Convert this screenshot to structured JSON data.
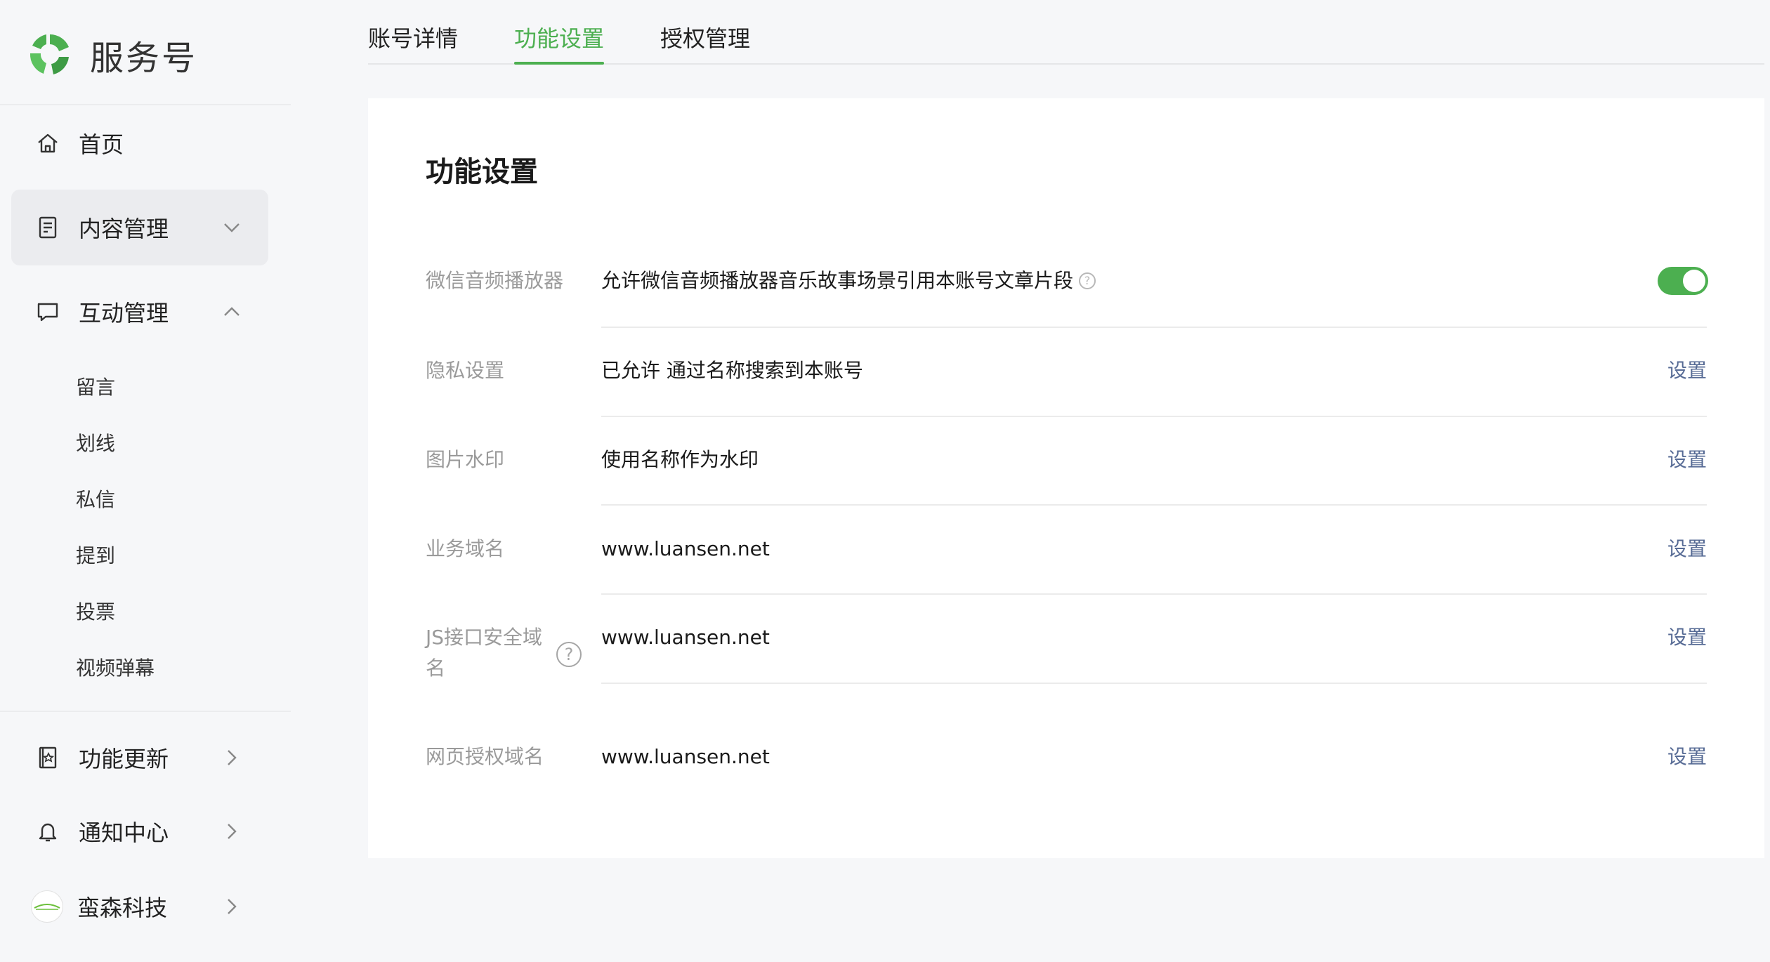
{
  "brand": {
    "name": "服务号"
  },
  "sidebar": {
    "home": "首页",
    "content": "内容管理",
    "interaction": "互动管理",
    "sub_items": [
      "留言",
      "划线",
      "私信",
      "提到",
      "投票",
      "视频弹幕"
    ],
    "updates": "功能更新",
    "notifications": "通知中心",
    "account": "蛮森科技"
  },
  "tabs": [
    "账号详情",
    "功能设置",
    "授权管理"
  ],
  "active_tab": "功能设置",
  "panel": {
    "title": "功能设置",
    "rows": [
      {
        "label": "微信音频播放器",
        "value": "允许微信音频播放器音乐故事场景引用本账号文章片段",
        "toggle": "on"
      },
      {
        "label": "隐私设置",
        "value": "已允许 通过名称搜索到本账号",
        "action": "设置"
      },
      {
        "label": "图片水印",
        "value": "使用名称作为水印",
        "action": "设置"
      },
      {
        "label": "业务域名",
        "value": "www.luansen.net",
        "action": "设置"
      },
      {
        "label_line1": "JS接口安全域",
        "label_line2": "名",
        "value": "www.luansen.net",
        "action": "设置"
      },
      {
        "label": "网页授权域名",
        "value": "www.luansen.net",
        "action": "设置"
      }
    ]
  },
  "colors": {
    "accent": "#4caf50",
    "link": "#576b95",
    "label": "#9a9a9a"
  }
}
